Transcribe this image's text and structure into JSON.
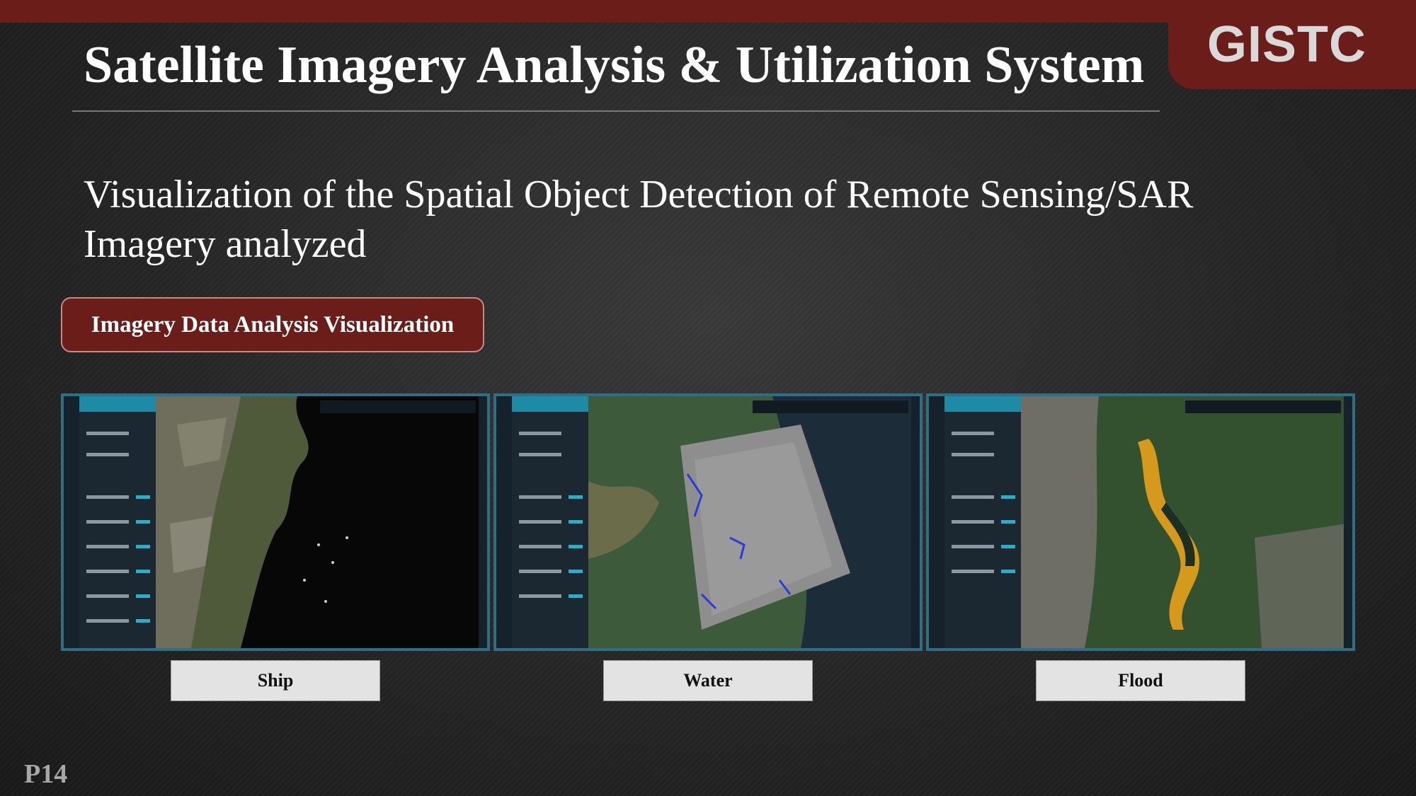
{
  "header": {
    "title": "Satellite Imagery Analysis & Utilization System",
    "logo_text": "GISTC"
  },
  "subtitle": "Visualization of the Spatial Object Detection of Remote Sensing/SAR Imagery analyzed",
  "section_button": "Imagery Data Analysis Visualization",
  "panels": [
    {
      "label": "Ship"
    },
    {
      "label": "Water"
    },
    {
      "label": "Flood"
    }
  ],
  "page_number": "P14",
  "colors": {
    "accent": "#6b1d19",
    "frame": "#2f6f86",
    "highlight_flood": "#d59a1c",
    "highlight_water": "#2a3bd8"
  }
}
